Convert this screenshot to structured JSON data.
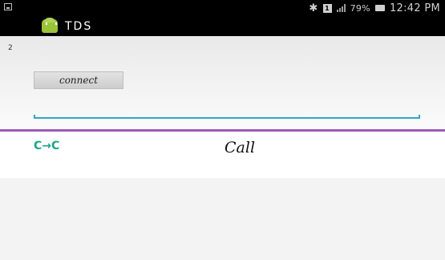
{
  "status_bar": {
    "battery_percent": "79%",
    "time": "12:42 PM",
    "sim_label": "1",
    "icons": [
      "gallery-icon",
      "bluetooth-icon",
      "sim-icon",
      "signal-icon",
      "battery-icon"
    ]
  },
  "action_bar": {
    "title": "TDS",
    "app_icon": "android-icon"
  },
  "main": {
    "count": "2",
    "connect_label": "connect",
    "input_value": "",
    "input_accent": "#2fa6c9"
  },
  "call_bar": {
    "connection_icon_text": "C→C",
    "call_label": "Call",
    "accent": "#9b59b6",
    "icon_color": "#1aa58a"
  }
}
